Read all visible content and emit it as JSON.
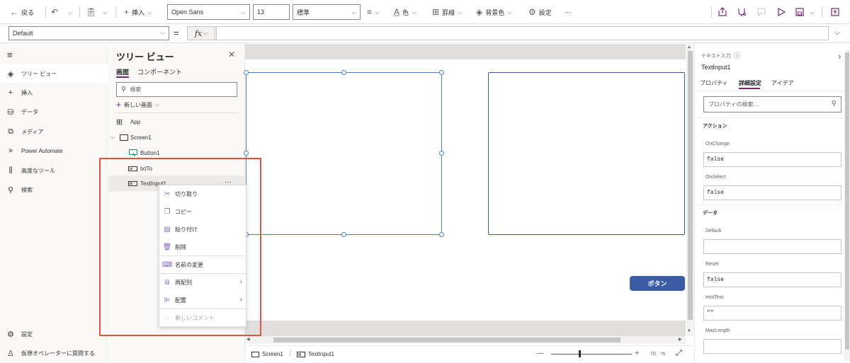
{
  "toolbar": {
    "back_label": "戻る",
    "insert_label": "挿入",
    "font_family": "Open Sans",
    "font_size": "13",
    "font_weight": "標準",
    "color_label": "色",
    "border_label": "罫線",
    "fill_label": "背景色",
    "settings_label": "設定",
    "more_label": "···"
  },
  "formula": {
    "property": "Default",
    "equals": "=",
    "fx_label": "fx"
  },
  "nav": {
    "items": [
      {
        "label": "ツリー ビュー",
        "icon": "layers-icon"
      },
      {
        "label": "挿入",
        "icon": "plus-icon"
      },
      {
        "label": "データ",
        "icon": "database-icon"
      },
      {
        "label": "メディア",
        "icon": "media-icon"
      },
      {
        "label": "Power Automate",
        "icon": "power-automate-icon"
      },
      {
        "label": "高度なツール",
        "icon": "tools-icon"
      },
      {
        "label": "検索",
        "icon": "search-icon"
      }
    ],
    "bottom": [
      {
        "label": "設定",
        "icon": "gear-icon"
      },
      {
        "label": "仮想オペレーターに質問する",
        "icon": "copilot-icon"
      }
    ]
  },
  "tree": {
    "title": "ツリー ビュー",
    "close": "✕",
    "tabs": [
      "画面",
      "コンポーネント"
    ],
    "search_placeholder": "検索",
    "new_screen": "新しい画面",
    "app_label": "App",
    "screen_label": "Screen1",
    "children": [
      "Button1",
      "txtTo",
      "TextInput1"
    ],
    "more": "···"
  },
  "context_menu": {
    "items": [
      {
        "label": "切り取り",
        "icon": "scissors-icon"
      },
      {
        "label": "コピー",
        "icon": "copy-icon"
      },
      {
        "label": "貼り付け",
        "icon": "paste-icon"
      },
      {
        "label": "削除",
        "icon": "delete-icon"
      },
      {
        "label": "名前の変更",
        "icon": "rename-icon"
      },
      {
        "label": "再配列",
        "icon": "reorder-icon"
      },
      {
        "label": "配置",
        "icon": "align-icon"
      },
      {
        "label": "新しいコメント",
        "icon": "comment-icon"
      }
    ]
  },
  "canvas": {
    "button_label": "ボタン"
  },
  "status": {
    "screen_label": "Screen1",
    "control_label": "TextInput1",
    "zoom_value": "70",
    "zoom_unit": "%",
    "minus": "—",
    "plus": "+"
  },
  "props": {
    "type_label": "テキスト入力",
    "control_name": "TextInput1",
    "tabs": [
      "プロパティ",
      "詳細設定",
      "アイデア"
    ],
    "search_placeholder": "プロパティの検索...",
    "section_action": "アクション",
    "section_data": "データ",
    "fields": [
      {
        "label": "OnChange",
        "value": "false"
      },
      {
        "label": "OnSelect",
        "value": "false"
      },
      {
        "label": "Default",
        "value": ""
      },
      {
        "label": "Reset",
        "value": "false"
      },
      {
        "label": "HintText",
        "value": "\"\""
      },
      {
        "label": "MaxLength",
        "value": ""
      }
    ]
  },
  "colors": {
    "accent": "#742774",
    "primary_button": "#3b5ba5",
    "highlight_box": "#e0533f",
    "selection": "#4a7fc5"
  }
}
